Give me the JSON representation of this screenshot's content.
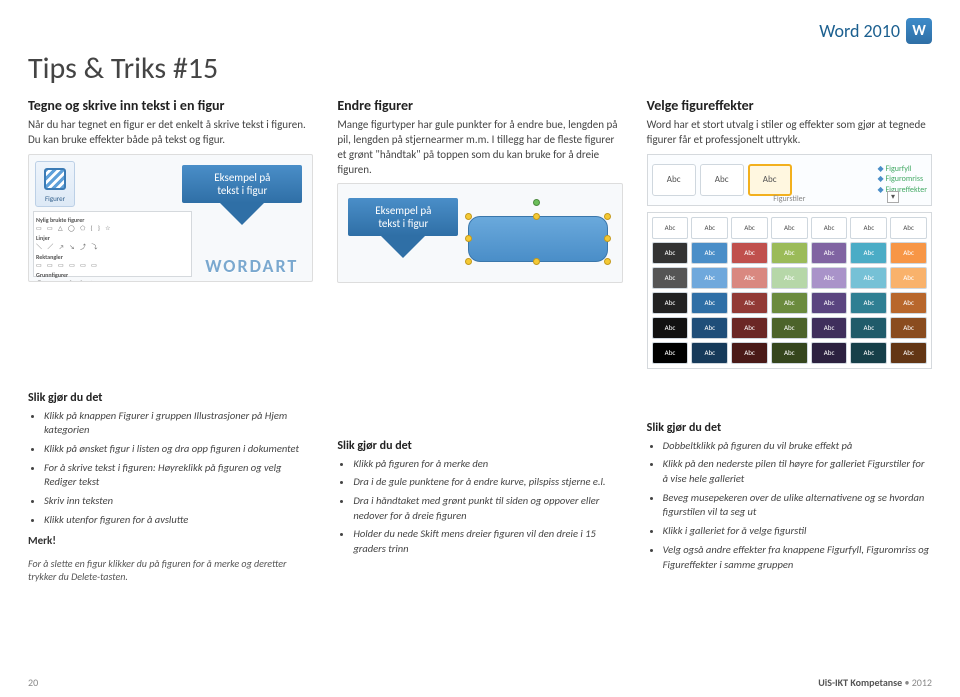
{
  "header": {
    "product": "Word 2010",
    "icon_letter": "W"
  },
  "title": "Tips & Triks #15",
  "col1": {
    "heading": "Tegne og skrive inn tekst i en figur",
    "body": "Når du har tegnet en figur er det enkelt å skrive tekst i figuren. Du kan bruke effekter både på tekst og figur.",
    "figurer_label": "Figurer",
    "panel": {
      "recent": "Nylig brukte figurer",
      "recent_shapes": "▭ ▭ △ ◯ ⬠ { } ☆",
      "lines": "Linjer",
      "lines_shapes": "＼ ／ ↗ ↘ ⤴ ⤵",
      "rect": "Rektangler",
      "rect_shapes": "▭ ▭ ▭ ▭ ▭ ▭",
      "basic": "Grunnfigurer",
      "basic_shapes": "◯ △ ◇ ⬠ ⬡ ☆ ☁"
    },
    "callout_line1": "Eksempel på",
    "callout_line2": "tekst i figur",
    "wordart": "WORDART"
  },
  "col2": {
    "heading": "Endre figurer",
    "body": "Mange figurtyper har gule punkter for å endre bue, lengden på pil, lengden på stjernearmer m.m. I tillegg har de fleste figurer et grønt \"håndtak\" på toppen som du kan bruke for å dreie figuren."
  },
  "col3": {
    "heading": "Velge figureffekter",
    "body": "Word har et stort utvalg i stiler og effekter som gjør at tegnede figurer får et professjonelt uttrykk.",
    "chip": "Abc",
    "opts": {
      "a": "Figurfyll",
      "b": "Figuromriss",
      "c": "Figureffekter"
    },
    "ribbon_caption": "Figurstiler",
    "gallery_colors": [
      [
        "#fff",
        "#fff",
        "#fff",
        "#fff",
        "#fff",
        "#fff",
        "#fff"
      ],
      [
        "#333",
        "#4a8ec8",
        "#c0504d",
        "#9bbb59",
        "#8064a2",
        "#4bacc6",
        "#f79646"
      ],
      [
        "#555",
        "#6fa8dc",
        "#d98880",
        "#b6d7a8",
        "#a993c9",
        "#76c1d6",
        "#f9b26b"
      ],
      [
        "#222",
        "#2f6fa6",
        "#923a36",
        "#6b8b3e",
        "#5a4580",
        "#2f7f93",
        "#b8672c"
      ],
      [
        "#111",
        "#1f4e79",
        "#6b2725",
        "#4c632a",
        "#3f2f5c",
        "#205b6a",
        "#8a4c1f"
      ],
      [
        "#000",
        "#163a5a",
        "#4a1a18",
        "#35461d",
        "#2c2140",
        "#163f49",
        "#633615"
      ]
    ]
  },
  "how1": {
    "title": "Slik gjør du det",
    "items": [
      "Klikk på knappen Figurer i gruppen Illustrasjoner på Hjem kategorien",
      "Klikk på ønsket figur i listen og dra opp figuren i dokumentet",
      "For å skrive tekst i figuren: Høyreklikk på figuren og velg Rediger tekst",
      "Skriv inn teksten",
      "Klikk utenfor figuren for å avslutte"
    ],
    "note_h": "Merk!",
    "note_b": "For å slette en figur klikker du på figuren for å merke og deretter trykker du Delete-tasten."
  },
  "how2": {
    "title": "Slik gjør du det",
    "items": [
      "Klikk på figuren for å merke den",
      "Dra i de gule punktene for å endre kurve, pilspiss stjerne e.l.",
      "Dra i håndtaket med grønt punkt til siden og oppover eller nedover for å dreie figuren",
      "Holder du nede Skift mens dreier figuren vil den dreie i 15 graders trinn"
    ]
  },
  "how3": {
    "title": "Slik gjør du det",
    "items": [
      "Dobbeltklikk på figuren du vil bruke effekt på",
      "Klikk på den nederste pilen til høyre for galleriet Figurstiler for å vise hele galleriet",
      "Beveg musepekeren over de ulike alternativene og se hvordan figurstilen vil ta seg ut",
      "Klikk i galleriet for å velge figurstil",
      "Velg også andre effekter fra knappene Figurfyll, Figuromriss og Figureffekter i samme gruppen"
    ]
  },
  "footer": {
    "page": "20",
    "org": "UiS-IKT Kompetanse",
    "year": "2012"
  }
}
